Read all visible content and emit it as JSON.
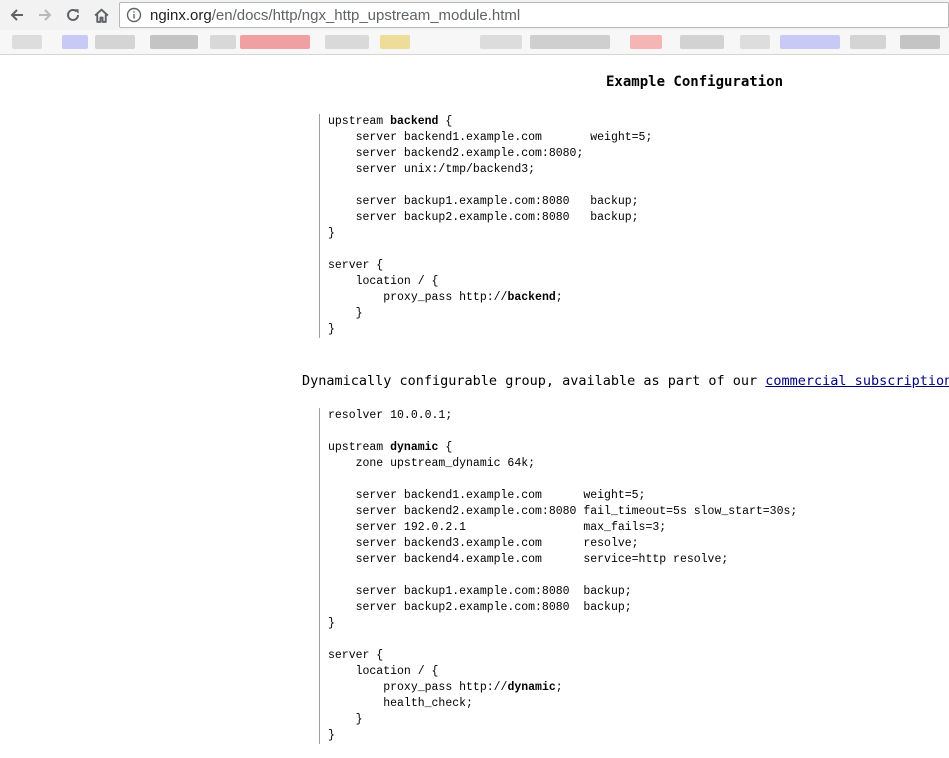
{
  "browser": {
    "url_host": "nginx.org",
    "url_path": "/en/docs/http/ngx_http_upstream_module.html",
    "bookmark_colors": [
      "#dddddd",
      "#c9c9f5",
      "#d4d4d4",
      "#c4c4c4",
      "#d8d8d8",
      "#f0a0a0",
      "#d9d9d9",
      "#eedd99",
      "#dcdcdc",
      "#cfcfcf",
      "#f5b5b5",
      "#d2d2d2"
    ]
  },
  "page": {
    "heading": "Example Configuration",
    "para_text": "Dynamically configurable group, available as part of our ",
    "para_link": "commercial subscription",
    "para_end": ":",
    "example1": [
      [
        {
          "t": "upstream "
        },
        {
          "t": "backend",
          "b": true
        },
        {
          "t": " {"
        }
      ],
      [
        {
          "t": "    server backend1.example.com       weight=5;"
        }
      ],
      [
        {
          "t": "    server backend2.example.com:8080;"
        }
      ],
      [
        {
          "t": "    server unix:/tmp/backend3;"
        }
      ],
      [
        {
          "t": ""
        }
      ],
      [
        {
          "t": "    server backup1.example.com:8080   backup;"
        }
      ],
      [
        {
          "t": "    server backup2.example.com:8080   backup;"
        }
      ],
      [
        {
          "t": "}"
        }
      ],
      [
        {
          "t": ""
        }
      ],
      [
        {
          "t": "server {"
        }
      ],
      [
        {
          "t": "    location / {"
        }
      ],
      [
        {
          "t": "        proxy_pass http://"
        },
        {
          "t": "backend",
          "b": true
        },
        {
          "t": ";"
        }
      ],
      [
        {
          "t": "    }"
        }
      ],
      [
        {
          "t": "}"
        }
      ]
    ],
    "example2": [
      [
        {
          "t": "resolver 10.0.0.1;"
        }
      ],
      [
        {
          "t": ""
        }
      ],
      [
        {
          "t": "upstream "
        },
        {
          "t": "dynamic",
          "b": true
        },
        {
          "t": " {"
        }
      ],
      [
        {
          "t": "    zone upstream_dynamic 64k;"
        }
      ],
      [
        {
          "t": ""
        }
      ],
      [
        {
          "t": "    server backend1.example.com      weight=5;"
        }
      ],
      [
        {
          "t": "    server backend2.example.com:8080 fail_timeout=5s slow_start=30s;"
        }
      ],
      [
        {
          "t": "    server 192.0.2.1                 max_fails=3;"
        }
      ],
      [
        {
          "t": "    server backend3.example.com      resolve;"
        }
      ],
      [
        {
          "t": "    server backend4.example.com      service=http resolve;"
        }
      ],
      [
        {
          "t": ""
        }
      ],
      [
        {
          "t": "    server backup1.example.com:8080  backup;"
        }
      ],
      [
        {
          "t": "    server backup2.example.com:8080  backup;"
        }
      ],
      [
        {
          "t": "}"
        }
      ],
      [
        {
          "t": ""
        }
      ],
      [
        {
          "t": "server {"
        }
      ],
      [
        {
          "t": "    location / {"
        }
      ],
      [
        {
          "t": "        proxy_pass http://"
        },
        {
          "t": "dynamic",
          "b": true
        },
        {
          "t": ";"
        }
      ],
      [
        {
          "t": "        health_check;"
        }
      ],
      [
        {
          "t": "    }"
        }
      ],
      [
        {
          "t": "}"
        }
      ]
    ]
  }
}
